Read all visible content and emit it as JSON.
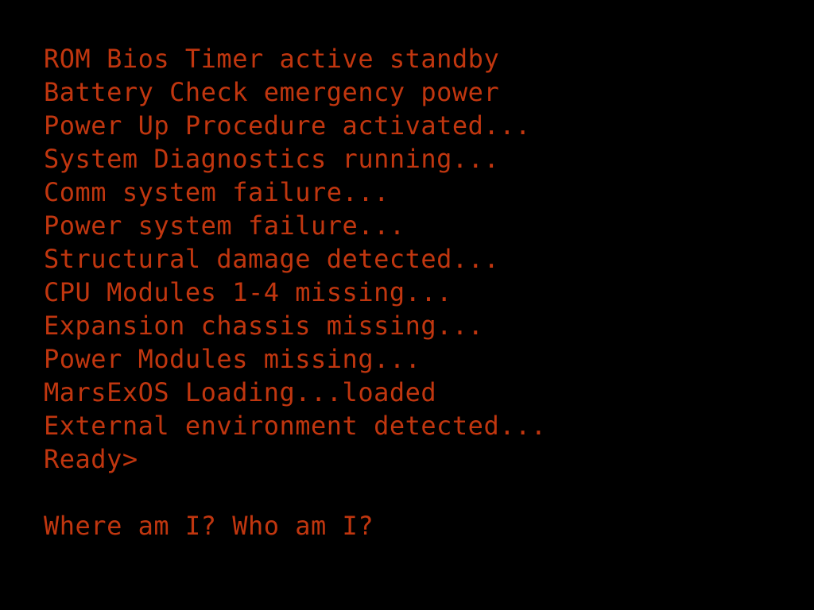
{
  "colors": {
    "background": "#000000",
    "text": "#c0360f"
  },
  "terminal": {
    "lines": [
      "ROM Bios Timer active standby",
      "Battery Check emergency power",
      "Power Up Procedure activated...",
      "System Diagnostics running...",
      "Comm system failure...",
      "Power system failure...",
      "Structural damage detected...",
      "CPU Modules 1-4 missing...",
      "Expansion chassis missing...",
      "Power Modules missing...",
      "MarsExOS Loading...loaded",
      "External environment detected...",
      "Ready>"
    ],
    "question": "Where am I? Who am I?"
  }
}
